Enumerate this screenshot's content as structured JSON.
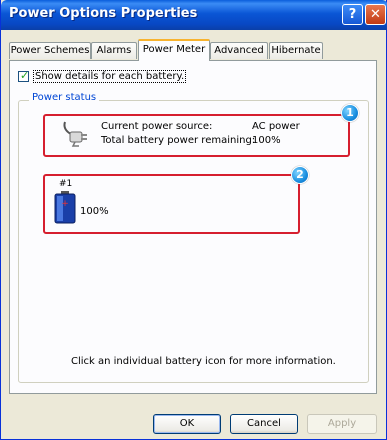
{
  "window": {
    "title": "Power Options Properties",
    "help_button": "?",
    "close_button": "✕"
  },
  "tabs": [
    {
      "label": "Power Schemes",
      "active": false
    },
    {
      "label": "Alarms",
      "active": false
    },
    {
      "label": "Power Meter",
      "active": true
    },
    {
      "label": "Advanced",
      "active": false
    },
    {
      "label": "Hibernate",
      "active": false
    }
  ],
  "show_details": {
    "label": "Show details for each battery.",
    "checked": true
  },
  "power_status": {
    "legend": "Power status",
    "current_source_label": "Current power source:",
    "current_source_value": "AC power",
    "remaining_label": "Total battery power remaining:",
    "remaining_value": "100%",
    "battery_number": "#1",
    "battery_percent": "100%",
    "battery_level": 1.0
  },
  "callouts": {
    "badge1": "1",
    "badge2": "2"
  },
  "info_text": "Click an individual battery icon for more information.",
  "buttons": {
    "ok": "OK",
    "cancel": "Cancel",
    "apply": "Apply"
  },
  "colors": {
    "titlebar": "#0a56d6",
    "highlight": "#d61f2f",
    "active_tab_accent": "#f8b32e",
    "group_legend": "#0046d5"
  }
}
